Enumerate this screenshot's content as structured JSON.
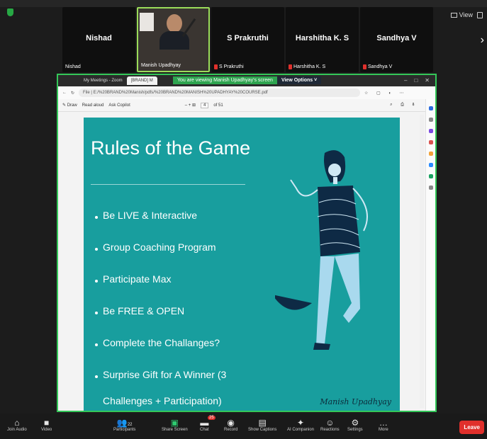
{
  "participants": [
    {
      "name": "Nishad",
      "label": "Nishad",
      "muted": false
    },
    {
      "name": "",
      "label": "Manish Upadhyay",
      "muted": false,
      "video": true
    },
    {
      "name": "S Prakruthi",
      "label": "S Prakruthi",
      "muted": true
    },
    {
      "name": "Harshitha K. S",
      "label": "Harshitha K. S",
      "muted": true
    },
    {
      "name": "Sandhya V",
      "label": "Sandhya V",
      "muted": true
    }
  ],
  "view_label": "View",
  "banner": {
    "viewing": "You are viewing  Manish Upadhyay's screen",
    "options": "View Options"
  },
  "browser": {
    "tab1": "My Meetings - Zoom",
    "tab2": "[BRAND] M",
    "url": "File | E:/%20BRAND%20Manish/pdfs/%20BRAND%20MANISH%20UPADHYAY%20COURSE.pdf",
    "pdf_read_aloud": "Read aloud",
    "pdf_copilot": "Ask Copilot",
    "pdf_draw": "Draw",
    "page_current": "4",
    "page_total": "of 51"
  },
  "slide": {
    "title": "Rules of the Game",
    "rules": [
      "Be LIVE & Interactive",
      "Group Coaching Program",
      "Participate Max",
      "Be FREE & OPEN",
      "Complete the Challanges?",
      "Surprise Gift for A Winner (3 Challenges + Participation)"
    ],
    "signature": "Manish Upadhyay"
  },
  "toolbar": {
    "items": [
      {
        "label": "Join Audio",
        "icon": "headphones-icon"
      },
      {
        "label": "Video",
        "icon": "video-off-icon"
      },
      {
        "label": "Participants",
        "icon": "participants-icon",
        "count": "22"
      },
      {
        "label": "Share Screen",
        "icon": "share-screen-icon"
      },
      {
        "label": "Chat",
        "icon": "chat-icon",
        "badge": "25"
      },
      {
        "label": "Record",
        "icon": "record-icon"
      },
      {
        "label": "Show Captions",
        "icon": "captions-icon"
      },
      {
        "label": "AI Companion",
        "icon": "ai-companion-icon"
      },
      {
        "label": "Reactions",
        "icon": "reactions-icon"
      },
      {
        "label": "Settings",
        "icon": "settings-icon"
      },
      {
        "label": "More",
        "icon": "more-icon"
      }
    ],
    "leave": "Leave"
  },
  "colors": {
    "slide_bg": "#189e9e",
    "active_border": "#9bdc5a",
    "share_border": "#34c759",
    "leave": "#e0302c"
  }
}
